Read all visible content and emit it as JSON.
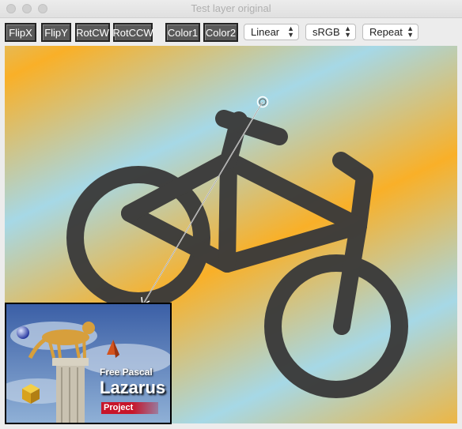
{
  "window": {
    "title": "Test layer original"
  },
  "toolbar": {
    "buttons": [
      {
        "label": "FlipX"
      },
      {
        "label": "FlipY"
      },
      {
        "label": "RotCW"
      },
      {
        "label": "RotCCW"
      },
      {
        "label": "Color1"
      },
      {
        "label": "Color2"
      }
    ],
    "selects": [
      {
        "value": "Linear"
      },
      {
        "value": "sRGB"
      },
      {
        "value": "Repeat"
      }
    ]
  },
  "logo": {
    "line1": "Free Pascal",
    "line2": "Lazarus",
    "line3": "Project"
  },
  "colors": {
    "gradient_blue": "#a6d8e6",
    "gradient_orange": "#f9b028",
    "bike": "#3a3a3a"
  },
  "icons": [
    "bicycle-icon",
    "chevron-updown-icon"
  ]
}
